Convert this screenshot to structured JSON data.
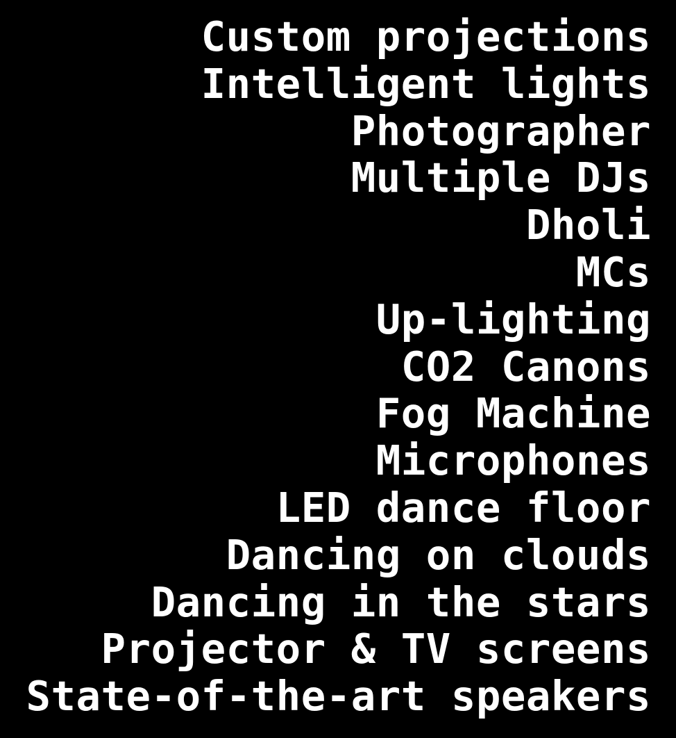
{
  "services": {
    "items": [
      "Custom projections",
      "Intelligent lights",
      "Photographer",
      "Multiple DJs",
      "Dholi",
      "MCs",
      "Up-lighting",
      "CO2 Canons",
      "Fog Machine",
      "Microphones",
      "LED dance floor",
      "Dancing on clouds",
      "Dancing in the stars",
      "Projector & TV screens",
      "State-of-the-art speakers"
    ]
  },
  "colors": {
    "background": "#000000",
    "text": "#ffffff"
  }
}
